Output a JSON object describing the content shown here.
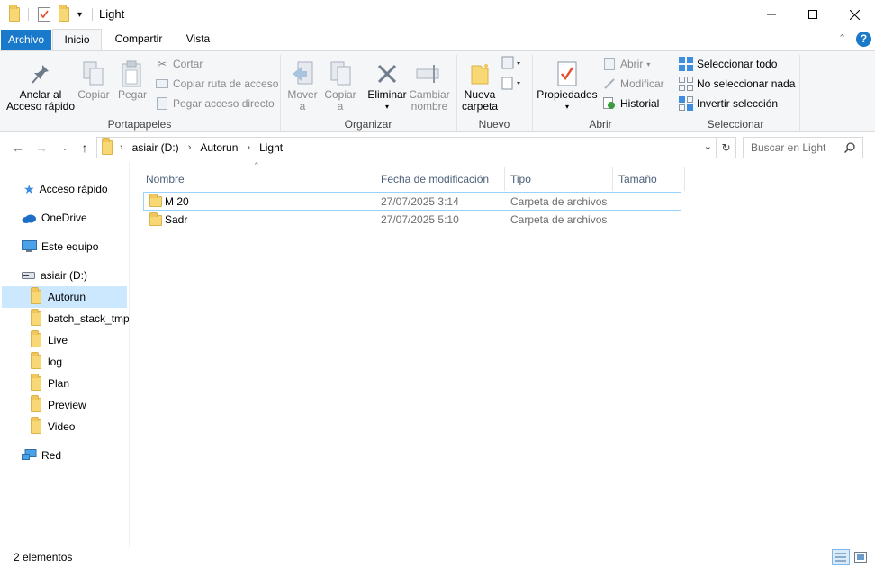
{
  "window": {
    "title": "Light",
    "minimize_icon": "minimize-icon",
    "maximize_icon": "maximize-icon",
    "close_icon": "close-icon"
  },
  "ribbon_tabs": [
    {
      "label": "Archivo"
    },
    {
      "label": "Inicio"
    },
    {
      "label": "Compartir"
    },
    {
      "label": "Vista"
    }
  ],
  "ribbon": {
    "portapapeles": {
      "label": "Portapapeles",
      "anclar": "Anclar al\nAcceso rápido",
      "copiar": "Copiar",
      "pegar": "Pegar",
      "cortar": "Cortar",
      "copiar_ruta": "Copiar ruta de acceso",
      "pegar_acceso": "Pegar acceso directo"
    },
    "organizar": {
      "label": "Organizar",
      "mover": "Mover\na",
      "copiar_a": "Copiar\na",
      "eliminar": "Eliminar",
      "cambiar_nombre": "Cambiar\nnombre"
    },
    "nuevo": {
      "label": "Nuevo",
      "nueva_carpeta": "Nueva\ncarpeta"
    },
    "abrir": {
      "label": "Abrir",
      "propiedades": "Propiedades",
      "abrir": "Abrir",
      "modificar": "Modificar",
      "historial": "Historial"
    },
    "seleccionar": {
      "label": "Seleccionar",
      "todo": "Seleccionar todo",
      "nada": "No seleccionar nada",
      "invertir": "Invertir selección"
    }
  },
  "address": {
    "crumbs": [
      "asiair (D:)",
      "Autorun",
      "Light"
    ],
    "search_placeholder": "Buscar en Light"
  },
  "sidebar": {
    "items": [
      {
        "label": "Acceso rápido",
        "icon": "star-icon"
      },
      {
        "label": "OneDrive",
        "icon": "cloud-icon"
      },
      {
        "label": "Este equipo",
        "icon": "computer-icon"
      },
      {
        "label": "asiair (D:)",
        "icon": "drive-icon"
      },
      {
        "label": "Autorun",
        "icon": "folder-icon",
        "selected": true
      },
      {
        "label": "batch_stack_tmp",
        "icon": "folder-icon"
      },
      {
        "label": "Live",
        "icon": "folder-icon"
      },
      {
        "label": "log",
        "icon": "folder-icon"
      },
      {
        "label": "Plan",
        "icon": "folder-icon"
      },
      {
        "label": "Preview",
        "icon": "folder-icon"
      },
      {
        "label": "Video",
        "icon": "folder-icon"
      },
      {
        "label": "Red",
        "icon": "network-icon"
      }
    ]
  },
  "columns": [
    "Nombre",
    "Fecha de modificación",
    "Tipo",
    "Tamaño"
  ],
  "files": [
    {
      "name": "M 20",
      "date": "27/07/2025 3:14",
      "type": "Carpeta de archivos",
      "size": ""
    },
    {
      "name": "Sadr",
      "date": "27/07/2025 5:10",
      "type": "Carpeta de archivos",
      "size": ""
    }
  ],
  "status": {
    "count": "2 elementos"
  },
  "colors": {
    "accent": "#1979ca",
    "selection": "#cce8ff",
    "folder": "#f8d775"
  }
}
